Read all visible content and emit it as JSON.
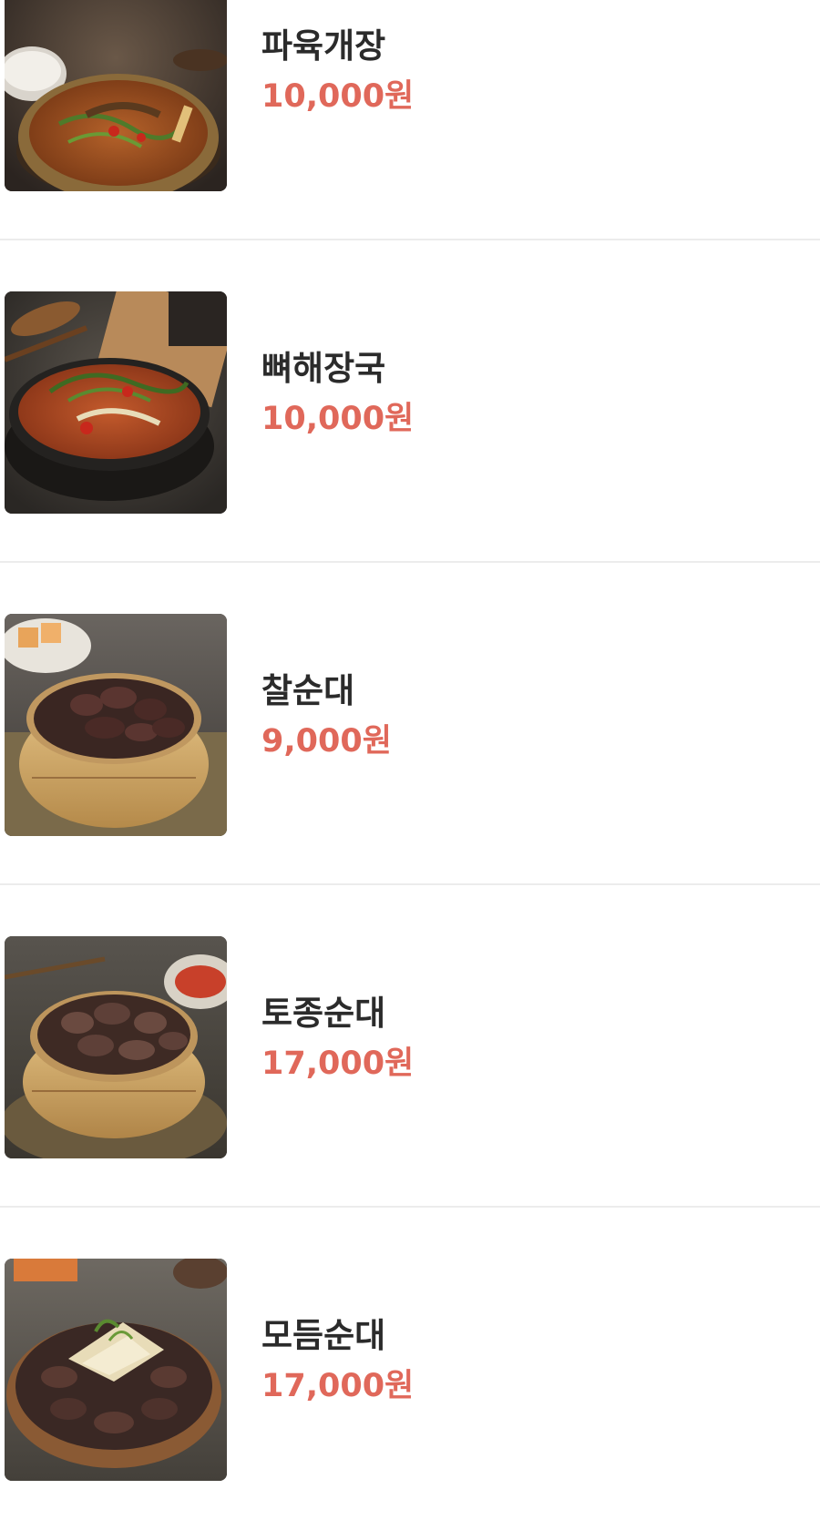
{
  "menu": {
    "items": [
      {
        "name": "파육개장",
        "price": "10,000원",
        "image": "yukgaejang-bowl"
      },
      {
        "name": "뼈해장국",
        "price": "10,000원",
        "image": "haejangguk-bowl"
      },
      {
        "name": "찰순대",
        "price": "9,000원",
        "image": "sundae-steamer"
      },
      {
        "name": "토종순대",
        "price": "17,000원",
        "image": "tojong-sundae-steamer"
      },
      {
        "name": "모듬순대",
        "price": "17,000원",
        "image": "modeum-sundae-platter"
      }
    ]
  },
  "colors": {
    "price": "#e0685a",
    "name": "#2b2b2b",
    "divider": "#ececec"
  }
}
